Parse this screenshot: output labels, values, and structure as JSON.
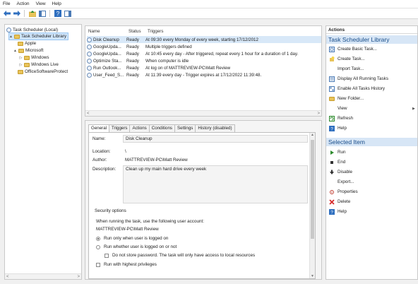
{
  "menu": [
    "File",
    "Action",
    "View",
    "Help"
  ],
  "toolbar": {
    "icons": [
      "back-arrow-icon",
      "forward-arrow-icon",
      "folder-up-icon",
      "show-hide-tree-icon",
      "help-icon",
      "show-hide-action-pane-icon"
    ]
  },
  "tree": {
    "root": "Task Scheduler (Local)",
    "library": "Task Scheduler Library",
    "items": [
      "Apple",
      "Microsoft",
      "Windows",
      "Windows Live",
      "OfficeSoftwareProtect"
    ]
  },
  "tasklist": {
    "headers": {
      "name": "Name",
      "status": "Status",
      "triggers": "Triggers"
    },
    "rows": [
      {
        "name": "Disk Cleanup",
        "status": "Ready",
        "triggers": "At 09:30 every Monday of every week, starting 17/12/2012"
      },
      {
        "name": "GoogleUpda...",
        "status": "Ready",
        "triggers": "Multiple triggers defined"
      },
      {
        "name": "GoogleUpda...",
        "status": "Ready",
        "triggers": "At 10:45 every day - After triggered, repeat every 1 hour for a duration of 1 day."
      },
      {
        "name": "Optimize Sta...",
        "status": "Ready",
        "triggers": "When computer is idle"
      },
      {
        "name": "Run Outlook...",
        "status": "Ready",
        "triggers": "At log on of MATTREVIEW-PC\\Matt Review"
      },
      {
        "name": "User_Feed_S...",
        "status": "Ready",
        "triggers": "At 11:39 every day - Trigger expires at 17/12/2022 11:39:48."
      }
    ]
  },
  "details": {
    "tabs": [
      "General",
      "Triggers",
      "Actions",
      "Conditions",
      "Settings",
      "History (disabled)"
    ],
    "name_label": "Name:",
    "name_value": "Disk Cleanup",
    "location_label": "Location:",
    "location_value": "\\",
    "author_label": "Author:",
    "author_value": "MATTREVIEW-PC\\Matt Review",
    "description_label": "Description:",
    "description_value": "Clean up my main hard drive every week",
    "security_title": "Security options",
    "security_account_prompt": "When running the task, use the following user account:",
    "security_account": "MATTREVIEW-PC\\Matt Review",
    "radio_logged_on": "Run only when user is logged on",
    "radio_logged_on_or_not": "Run whether user is logged on or not",
    "check_no_password": "Do not store password. The task will only have access to local resources",
    "check_highest_privileges": "Run with highest privileges"
  },
  "actions": {
    "header": "Actions",
    "section1": "Task Scheduler Library",
    "section1_items": [
      {
        "label": "Create Basic Task...",
        "icon": "create-basic-task-icon"
      },
      {
        "label": "Create Task...",
        "icon": "create-task-icon"
      },
      {
        "label": "Import Task...",
        "icon": ""
      },
      {
        "label": "Display All Running Tasks",
        "icon": "running-tasks-icon"
      },
      {
        "label": "Enable All Tasks History",
        "icon": "tasks-history-icon"
      },
      {
        "label": "New Folder...",
        "icon": "folder-icon"
      },
      {
        "label": "View",
        "icon": ""
      },
      {
        "label": "Refresh",
        "icon": "refresh-icon"
      },
      {
        "label": "Help",
        "icon": "help-icon"
      }
    ],
    "section2": "Selected Item",
    "section2_items": [
      {
        "label": "Run",
        "icon": "run-icon"
      },
      {
        "label": "End",
        "icon": "end-icon"
      },
      {
        "label": "Disable",
        "icon": "disable-icon"
      },
      {
        "label": "Export...",
        "icon": ""
      },
      {
        "label": "Properties",
        "icon": "properties-icon"
      },
      {
        "label": "Delete",
        "icon": "delete-icon"
      },
      {
        "label": "Help",
        "icon": "help-icon"
      }
    ]
  }
}
